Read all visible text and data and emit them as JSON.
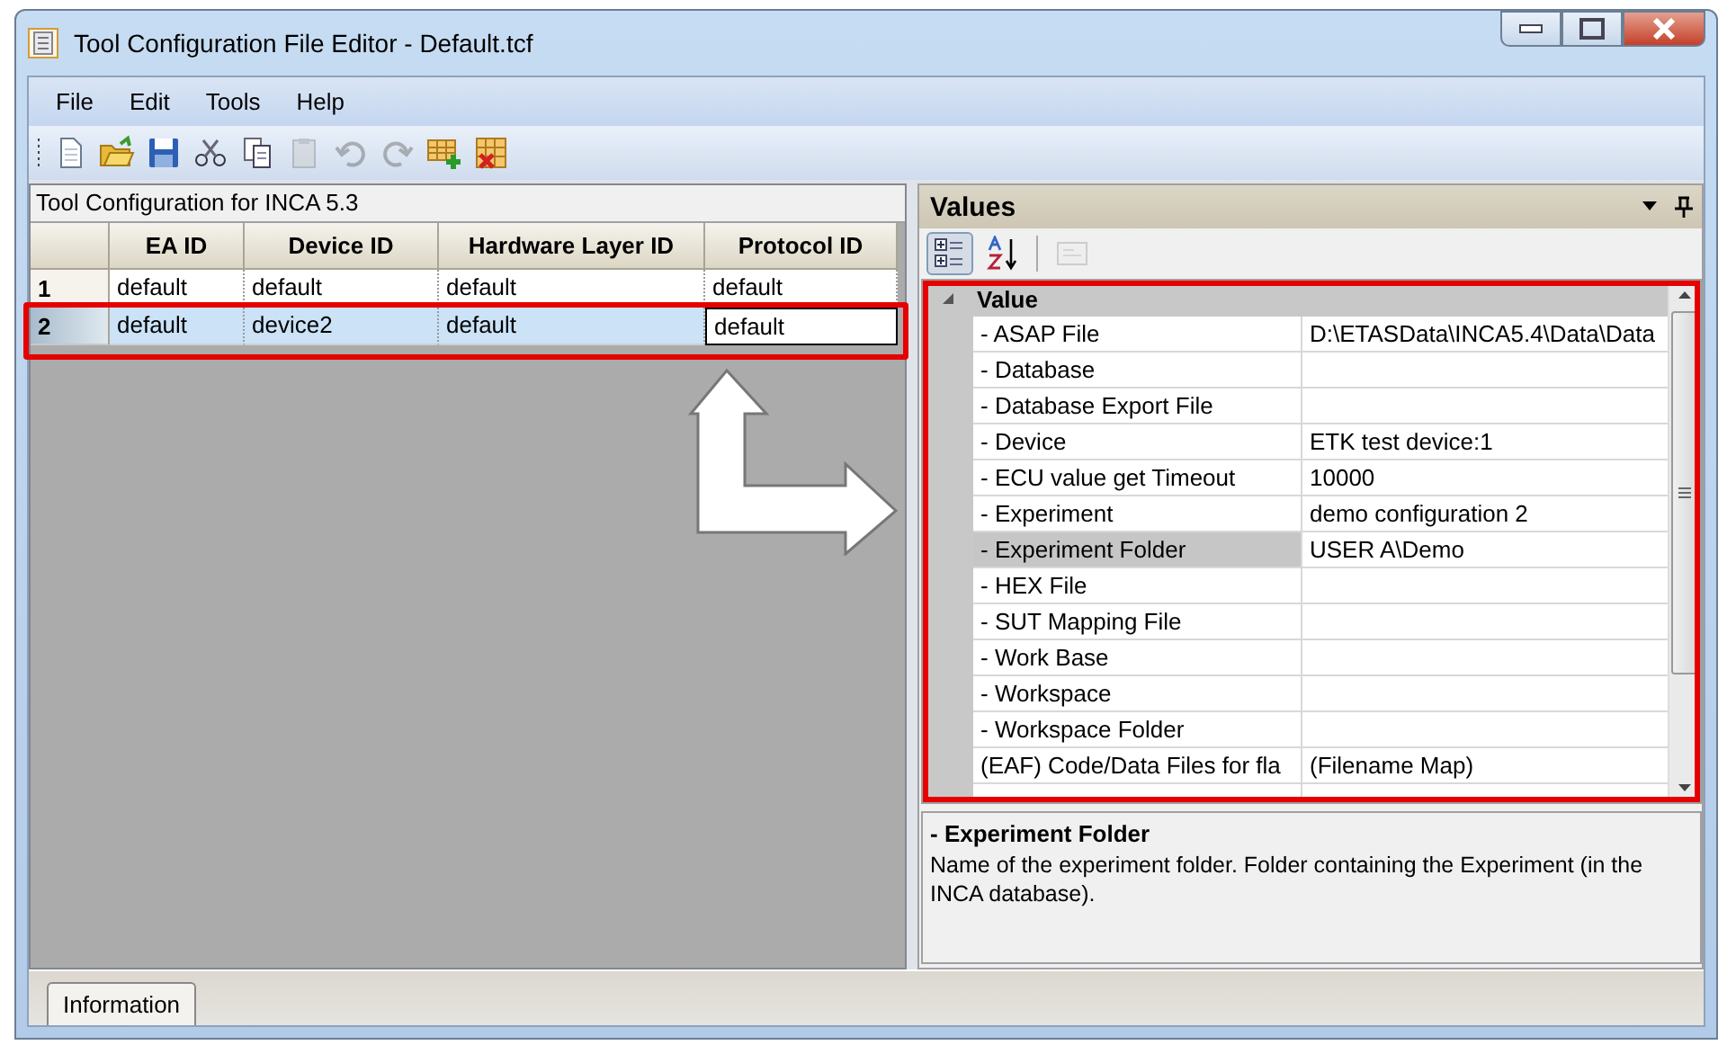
{
  "window": {
    "title": "Tool Configuration File Editor - Default.tcf"
  },
  "menu": [
    "File",
    "Edit",
    "Tools",
    "Help"
  ],
  "left_panel": {
    "caption": "Tool Configuration for INCA 5.3",
    "table": {
      "columns": [
        "EA ID",
        "Device ID",
        "Hardware Layer ID",
        "Protocol ID"
      ],
      "rows": [
        {
          "number": "1",
          "selected": false,
          "highlighted": false,
          "cells": [
            {
              "text": "default",
              "editing": false
            },
            {
              "text": "default",
              "editing": false
            },
            {
              "text": "default",
              "editing": false
            },
            {
              "text": "default",
              "editing": false
            }
          ]
        },
        {
          "number": "2",
          "selected": true,
          "highlighted": true,
          "cells": [
            {
              "text": "default",
              "editing": false
            },
            {
              "text": "device2",
              "editing": false
            },
            {
              "text": "default",
              "editing": false
            },
            {
              "text": "default",
              "editing": true
            }
          ]
        }
      ]
    }
  },
  "values_panel": {
    "title": "Values",
    "view_buttons": [
      {
        "kind": "categorized",
        "selected": true,
        "disabled": false
      },
      {
        "kind": "alphabetical",
        "selected": false,
        "disabled": false
      },
      {
        "kind": "pages",
        "selected": false,
        "disabled": true
      }
    ],
    "grid": {
      "highlighted": true,
      "category": {
        "name": "Value",
        "expanded": true
      },
      "properties": [
        {
          "name": "- ASAP File",
          "value": "D:\\ETASData\\INCA5.4\\Data\\Data",
          "selected": false
        },
        {
          "name": "- Database",
          "selected": false
        },
        {
          "name": "- Database Export File",
          "selected": false
        },
        {
          "name": "- Device",
          "value": "ETK test device:1",
          "selected": false
        },
        {
          "name": "- ECU value get Timeout",
          "value": "10000",
          "selected": false
        },
        {
          "name": "- Experiment",
          "value": "demo configuration 2",
          "selected": false
        },
        {
          "name": "- Experiment Folder",
          "value": "USER A\\Demo",
          "selected": true
        },
        {
          "name": "- HEX File",
          "selected": false
        },
        {
          "name": "- SUT Mapping File",
          "selected": false
        },
        {
          "name": "- Work Base",
          "selected": false
        },
        {
          "name": "- Workspace",
          "selected": false
        },
        {
          "name": "- Workspace Folder",
          "selected": false
        },
        {
          "name": "(EAF) Code/Data Files for fla",
          "value": "(Filename Map)",
          "selected": false
        }
      ]
    },
    "description": {
      "title": "- Experiment Folder",
      "text": "Name of the experiment folder. Folder containing the Experiment (in the INCA database)."
    }
  },
  "bottom_tabs": [
    {
      "label": "Information",
      "selected": true
    }
  ]
}
